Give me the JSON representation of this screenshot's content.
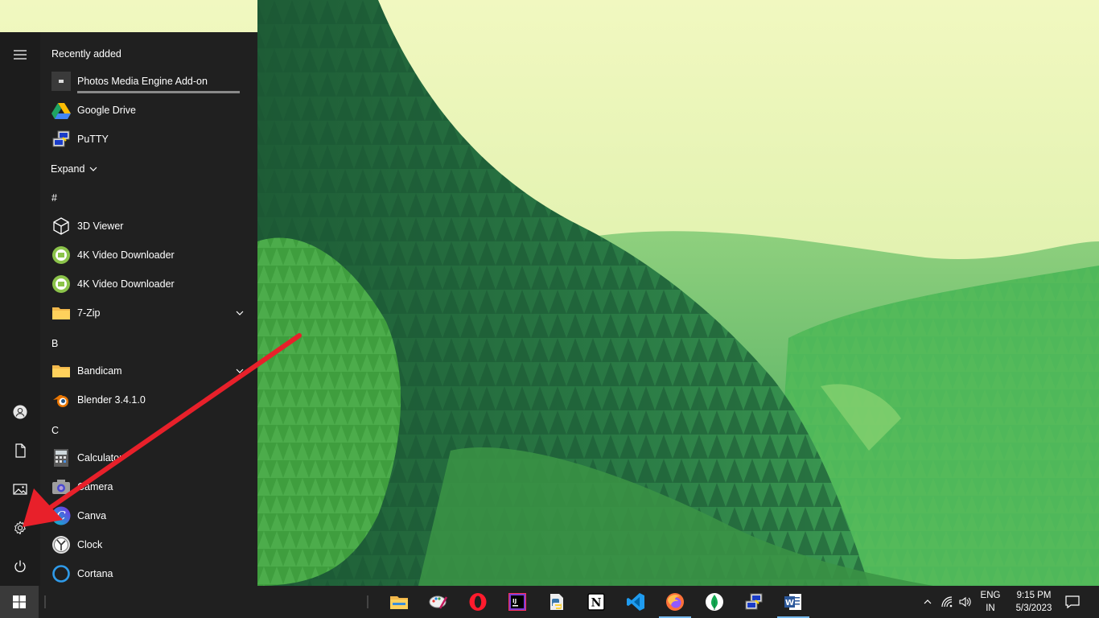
{
  "start_menu": {
    "recently_added_title": "Recently added",
    "recent_apps": [
      {
        "label": "Photos Media Engine Add-on",
        "icon": "photos-addon-icon",
        "progress": 1.0
      },
      {
        "label": "Google Drive",
        "icon": "google-drive-icon"
      },
      {
        "label": "PuTTY",
        "icon": "putty-icon"
      }
    ],
    "expand_label": "Expand",
    "groups": [
      {
        "letter": "#",
        "apps": [
          {
            "label": "3D Viewer",
            "icon": "3d-viewer-icon"
          },
          {
            "label": "4K Video Downloader",
            "icon": "4k-video-downloader-icon"
          },
          {
            "label": "4K Video Downloader",
            "icon": "4k-video-downloader-icon"
          },
          {
            "label": "7-Zip",
            "icon": "folder-icon",
            "expandable": true
          }
        ]
      },
      {
        "letter": "B",
        "apps": [
          {
            "label": "Bandicam",
            "icon": "folder-icon",
            "expandable": true
          },
          {
            "label": "Blender 3.4.1.0",
            "icon": "blender-icon"
          }
        ]
      },
      {
        "letter": "C",
        "apps": [
          {
            "label": "Calculator",
            "icon": "calculator-icon"
          },
          {
            "label": "Camera",
            "icon": "camera-icon"
          },
          {
            "label": "Canva",
            "icon": "canva-icon"
          },
          {
            "label": "Clock",
            "icon": "clock-icon"
          },
          {
            "label": "Cortana",
            "icon": "cortana-icon"
          }
        ]
      }
    ],
    "rail": [
      "hamburger-menu-icon",
      "user-account-icon",
      "documents-icon",
      "pictures-icon",
      "settings-gear-icon",
      "power-icon"
    ]
  },
  "taskbar": {
    "pinned_apps": [
      {
        "name": "file-explorer-icon",
        "running": false
      },
      {
        "name": "paint-icon",
        "running": false
      },
      {
        "name": "opera-browser-icon",
        "running": false
      },
      {
        "name": "intellij-idea-icon",
        "running": false
      },
      {
        "name": "python-idle-icon",
        "running": false
      },
      {
        "name": "notion-icon",
        "running": false
      },
      {
        "name": "vs-code-icon",
        "running": false
      },
      {
        "name": "firefox-icon",
        "running": true
      },
      {
        "name": "mongodb-compass-icon",
        "running": false
      },
      {
        "name": "putty-icon",
        "running": false
      },
      {
        "name": "microsoft-word-icon",
        "running": true
      }
    ],
    "tray": {
      "language_top": "ENG",
      "language_bottom": "IN",
      "time": "9:15 PM",
      "date": "5/3/2023"
    }
  },
  "colors": {
    "menu_bg": "#202020",
    "taskbar_bg": "#202020",
    "accent_blue": "#76b9ed",
    "annotation_arrow": "#e8202a"
  }
}
